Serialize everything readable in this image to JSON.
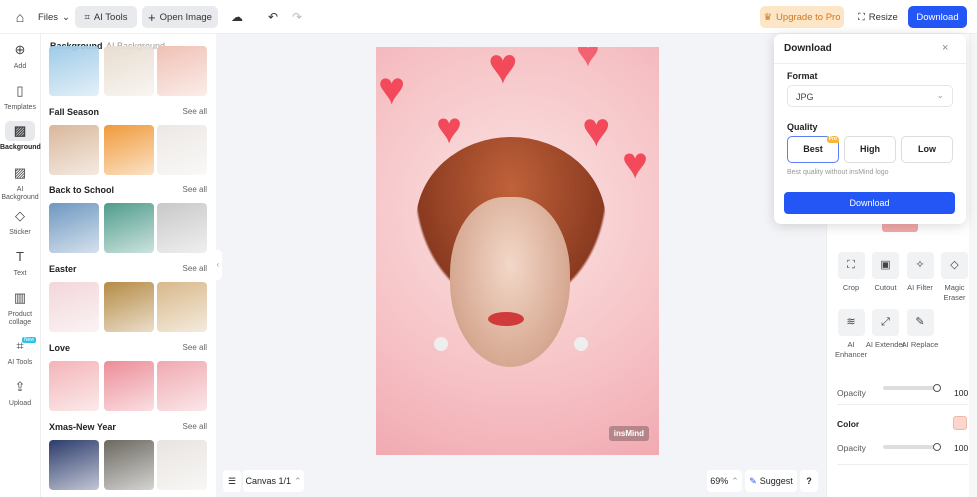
{
  "topbar": {
    "files": "Files",
    "ai_tools": "AI Tools",
    "open_image": "Open Image",
    "upgrade": "Upgrade to Pro",
    "resize": "Resize",
    "download": "Download"
  },
  "rail": [
    {
      "label": "Add",
      "icon": "⊕"
    },
    {
      "label": "Templates",
      "icon": "▯"
    },
    {
      "label": "Background",
      "icon": "▨"
    },
    {
      "label": "AI Background",
      "icon": "▨"
    },
    {
      "label": "Sticker",
      "icon": "◇"
    },
    {
      "label": "Text",
      "icon": "T"
    },
    {
      "label": "Product collage",
      "icon": "▥"
    },
    {
      "label": "AI Tools",
      "icon": "⌗",
      "badge": "New"
    },
    {
      "label": "Upload",
      "icon": "⇪"
    }
  ],
  "panel": {
    "tabs": [
      "Background",
      "AI Background"
    ],
    "see_all": "See all",
    "sections": [
      {
        "title": "Fall Season",
        "colors": [
          "#d9b79a",
          "#f09a3a",
          "#ece8e4"
        ]
      },
      {
        "title": "Back to School",
        "colors": [
          "#6d97c0",
          "#4f9c8c",
          "#c8c8c8"
        ]
      },
      {
        "title": "Easter",
        "colors": [
          "#f2d6da",
          "#b58b45",
          "#d8b88a"
        ]
      },
      {
        "title": "Love",
        "colors": [
          "#f3b4b8",
          "#ec8d98",
          "#f0a9b0"
        ]
      },
      {
        "title": "Xmas-New Year",
        "colors": [
          "#2b3b6b",
          "#6b6860",
          "#e8e4e0"
        ]
      }
    ],
    "top_row_colors": [
      "#9fcbe8",
      "#e8ddd0",
      "#f0c0b4"
    ]
  },
  "canvas": {
    "label": "Canvas 1/1",
    "zoom": "69%",
    "suggest": "Suggest",
    "help": "?",
    "watermark": "insMind"
  },
  "download_popup": {
    "title": "Download",
    "format_label": "Format",
    "format_value": "JPG",
    "quality_label": "Quality",
    "qualities": [
      "Best",
      "High",
      "Low"
    ],
    "pro_badge": "Pro",
    "selected": "Best",
    "hint": "Best quality without insMind logo",
    "button": "Download"
  },
  "right": {
    "tools": [
      "Crop",
      "Cutout",
      "AI Filter",
      "Magic Eraser",
      "AI Enhancer",
      "AI Extender",
      "AI Replace"
    ],
    "opacity_label": "Opacity",
    "opacity": 100,
    "color_label": "Color",
    "color": "#fcd5cc",
    "color_opacity": 100
  }
}
